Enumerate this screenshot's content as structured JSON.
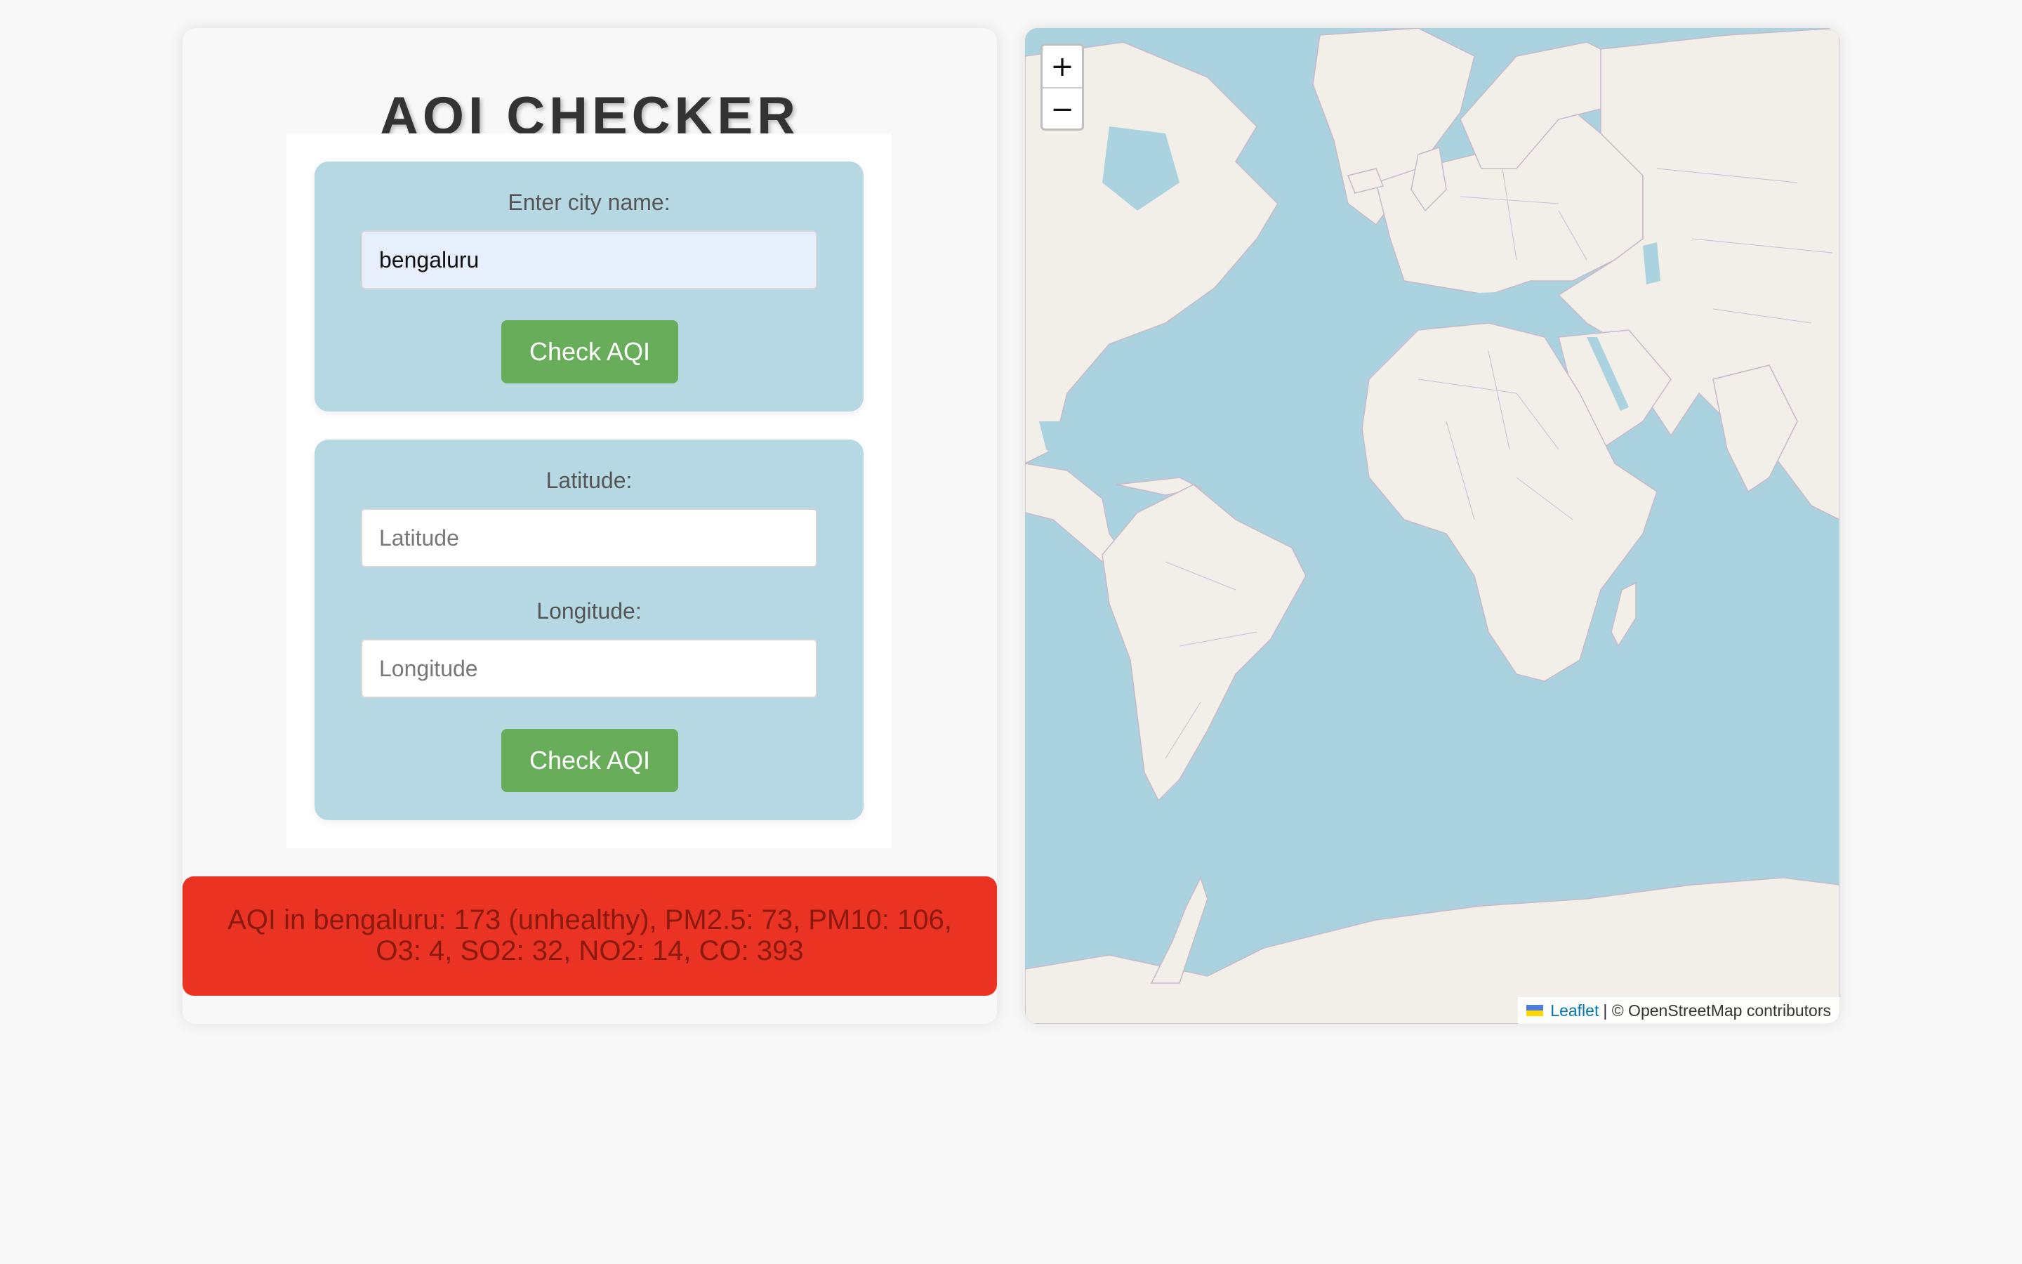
{
  "app": {
    "title": "AQI CHECKER"
  },
  "city_form": {
    "label": "Enter city name:",
    "value": "bengaluru",
    "placeholder": "",
    "button_label": "Check AQI"
  },
  "coords_form": {
    "latitude_label": "Latitude:",
    "latitude_value": "",
    "latitude_placeholder": "Latitude",
    "longitude_label": "Longitude:",
    "longitude_value": "",
    "longitude_placeholder": "Longitude",
    "button_label": "Check AQI"
  },
  "result": {
    "line1": "AQI in bengaluru: 173 (unhealthy), PM2.5: 73, PM10: 106,",
    "line2": "O3: 4, SO2: 32, NO2: 14, CO: 393",
    "status_color": "#ea3323"
  },
  "map": {
    "zoom_in_label": "+",
    "zoom_out_label": "−",
    "attribution_link": "Leaflet",
    "attribution_text": "| © OpenStreetMap contributors",
    "water_color": "#aad3df",
    "land_color": "#f2efe9"
  },
  "colors": {
    "form_bg": "#b6d8e3",
    "button_bg": "#68ad5a",
    "page_bg": "#f8f8f8"
  }
}
